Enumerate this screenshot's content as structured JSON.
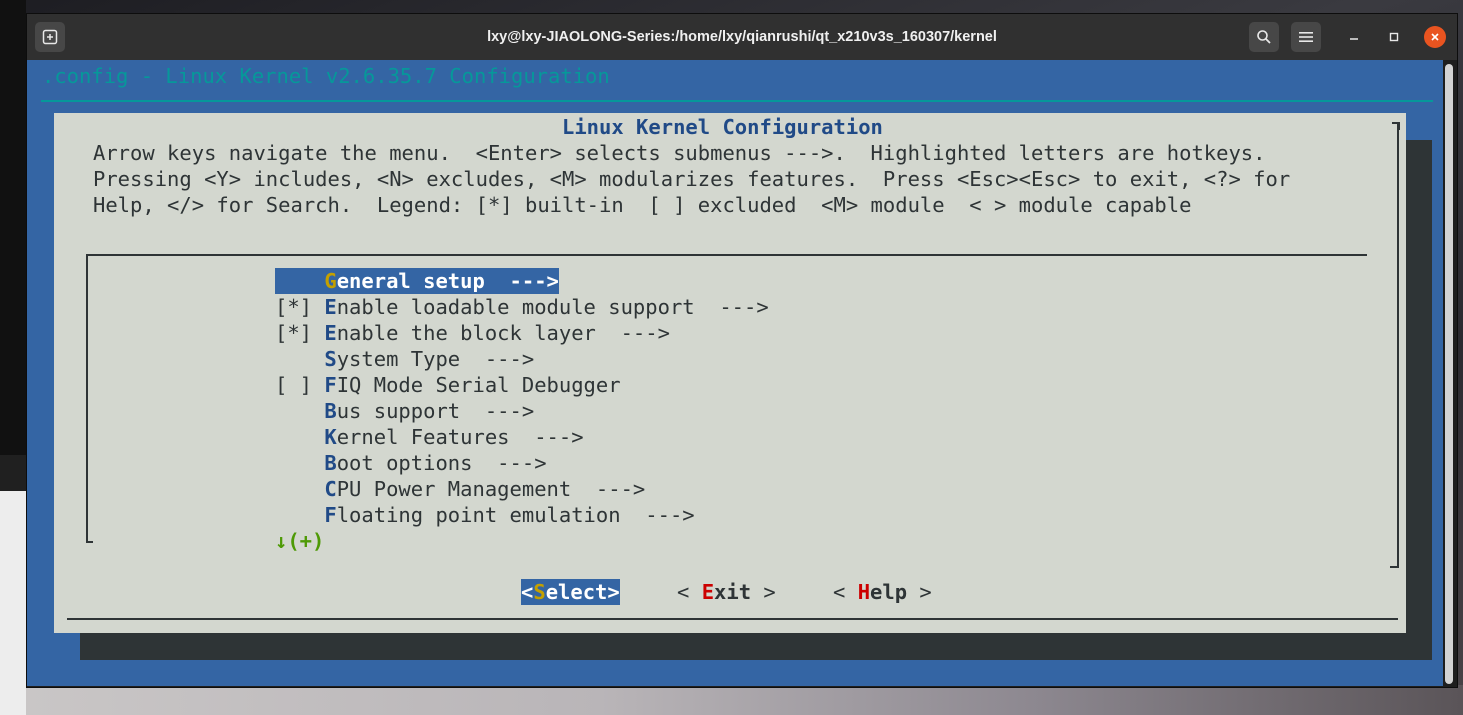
{
  "window": {
    "title": "lxy@lxy-JIAOLONG-Series:/home/lxy/qianrushi/qt_x210v3s_160307/kernel"
  },
  "icons": {
    "newtab": "new-tab-icon",
    "search": "search-icon",
    "menu": "hamburger-menu-icon",
    "minimize": "minimize-icon",
    "maximize": "maximize-icon",
    "close": "close-icon"
  },
  "terminal": {
    "header": ".config - Linux Kernel v2.6.35.7 Configuration",
    "dialog_title": "Linux Kernel Configuration",
    "help_lines": [
      "Arrow keys navigate the menu.  <Enter> selects submenus --->.  Highlighted letters are hotkeys.",
      "Pressing <Y> includes, <N> excludes, <M> modularizes features.  Press <Esc><Esc> to exit, <?> for",
      "Help, </> for Search.  Legend: [*] built-in  [ ] excluded  <M> module  < > module capable"
    ],
    "menu_items": [
      {
        "prefix": "    ",
        "hotkey": "G",
        "rest": "eneral setup  --->",
        "selected": true
      },
      {
        "prefix": "[*] ",
        "hotkey": "E",
        "rest": "nable loadable module support  --->",
        "selected": false
      },
      {
        "prefix": "[*] ",
        "hotkey": "E",
        "rest": "nable the block layer  --->",
        "selected": false
      },
      {
        "prefix": "    ",
        "hotkey": "S",
        "rest": "ystem Type  --->",
        "selected": false
      },
      {
        "prefix": "[ ] ",
        "hotkey": "F",
        "rest": "IQ Mode Serial Debugger",
        "selected": false
      },
      {
        "prefix": "    ",
        "hotkey": "B",
        "rest": "us support  --->",
        "selected": false
      },
      {
        "prefix": "    ",
        "hotkey": "K",
        "rest": "ernel Features  --->",
        "selected": false
      },
      {
        "prefix": "    ",
        "hotkey": "B",
        "rest": "oot options  --->",
        "selected": false
      },
      {
        "prefix": "    ",
        "hotkey": "C",
        "rest": "PU Power Management  --->",
        "selected": false
      },
      {
        "prefix": "    ",
        "hotkey": "F",
        "rest": "loating point emulation  --->",
        "selected": false
      }
    ],
    "more_indicator": "↓(+)",
    "buttons": {
      "select": {
        "open": "<",
        "hotkey": "S",
        "rest": "elect",
        "close": ">"
      },
      "exit": {
        "open": "< ",
        "hotkey": "E",
        "rest": "xit",
        "close": " >"
      },
      "help": {
        "open": "< ",
        "hotkey": "H",
        "rest": "elp",
        "close": " >"
      }
    }
  },
  "colors": {
    "screen_bg": "#3465a4",
    "dialog_bg": "#d3d7cf",
    "title_cyan": "#06989a",
    "hotkey_blue": "#204a87",
    "selected_hotkey": "#c4a000",
    "button_hotkey": "#cc0000",
    "more_green": "#4e9a06",
    "close_orange": "#e95420"
  }
}
